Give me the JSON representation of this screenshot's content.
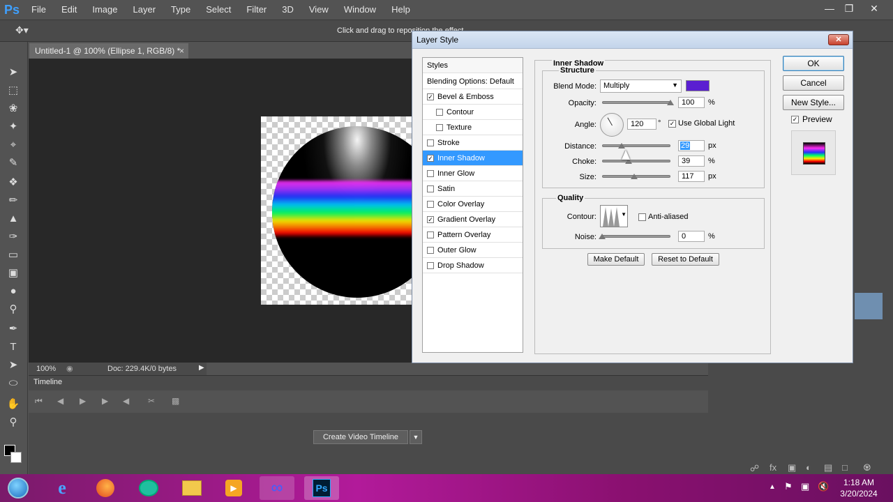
{
  "app": {
    "logo": "Ps",
    "menu": [
      "File",
      "Edit",
      "Image",
      "Layer",
      "Type",
      "Select",
      "Filter",
      "3D",
      "View",
      "Window",
      "Help"
    ],
    "hint": "Click and drag to reposition the effect."
  },
  "document": {
    "tab_title": "Untitled-1 @ 100% (Ellipse 1, RGB/8) *",
    "zoom": "100%",
    "doc_size": "Doc: 229.4K/0 bytes"
  },
  "timeline": {
    "title": "Timeline",
    "create_button": "Create Video Timeline"
  },
  "dialog": {
    "title": "Layer Style",
    "styles_header": "Styles",
    "blending_options": "Blending Options: Default",
    "styles": [
      {
        "label": "Bevel & Emboss",
        "checked": true,
        "indent": false
      },
      {
        "label": "Contour",
        "checked": false,
        "indent": true
      },
      {
        "label": "Texture",
        "checked": false,
        "indent": true
      },
      {
        "label": "Stroke",
        "checked": false,
        "indent": false
      },
      {
        "label": "Inner Shadow",
        "checked": true,
        "indent": false,
        "selected": true
      },
      {
        "label": "Inner Glow",
        "checked": false,
        "indent": false
      },
      {
        "label": "Satin",
        "checked": false,
        "indent": false
      },
      {
        "label": "Color Overlay",
        "checked": false,
        "indent": false
      },
      {
        "label": "Gradient Overlay",
        "checked": true,
        "indent": false
      },
      {
        "label": "Pattern Overlay",
        "checked": false,
        "indent": false
      },
      {
        "label": "Outer Glow",
        "checked": false,
        "indent": false
      },
      {
        "label": "Drop Shadow",
        "checked": false,
        "indent": false
      }
    ],
    "section_title": "Inner Shadow",
    "structure_title": "Structure",
    "blend_mode_label": "Blend Mode:",
    "blend_mode_value": "Multiply",
    "shadow_color": "#5a1fd1",
    "opacity_label": "Opacity:",
    "opacity_value": "100",
    "opacity_level": 1.0,
    "angle_label": "Angle:",
    "angle_value": "120",
    "angle_unit": "°",
    "use_global_light": "Use Global Light",
    "distance_label": "Distance:",
    "distance_value": "29",
    "distance_level": 0.29,
    "choke_label": "Choke:",
    "choke_value": "39",
    "choke_level": 0.39,
    "size_label": "Size:",
    "size_value": "117",
    "size_level": 0.47,
    "px": "px",
    "pct": "%",
    "quality_title": "Quality",
    "contour_label": "Contour:",
    "anti_aliased": "Anti-aliased",
    "noise_label": "Noise:",
    "noise_value": "0",
    "make_default": "Make Default",
    "reset_default": "Reset to Default",
    "ok": "OK",
    "cancel": "Cancel",
    "new_style": "New Style...",
    "preview": "Preview"
  },
  "taskbar": {
    "time": "1:18 AM",
    "date": "3/20/2024"
  }
}
